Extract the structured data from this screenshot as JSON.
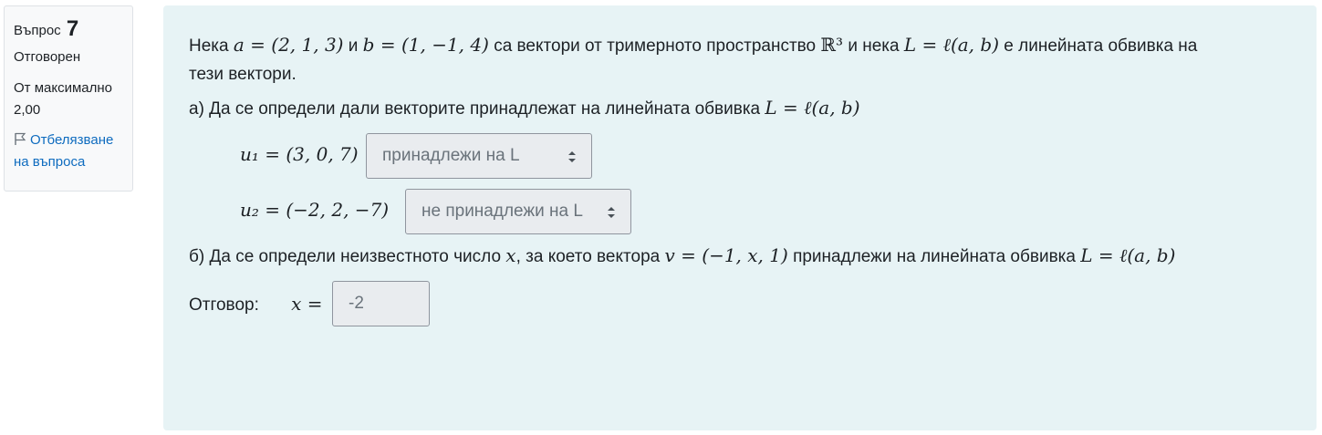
{
  "info": {
    "question_label": "Въпрос",
    "question_number": "7",
    "state": "Отговорен",
    "grade_line1": "От максимално",
    "grade_line2": "2,00",
    "flag_line1": "Отбелязване",
    "flag_line2": "на въпроса"
  },
  "question": {
    "intro_1": "Нека",
    "a_def": "a = (2, 1, 3)",
    "and": "и",
    "b_def": "b = (1, −1, 4)",
    "intro_2": "са вектори от тримерното пространство",
    "space": "ℝ³",
    "intro_3": "и нека",
    "L_def": "L = ℓ(a, b)",
    "intro_4": "е  линейната обвивка на",
    "intro_5": "тези вектори.",
    "part_a": "а) Да се определи дали векторите принадлежат на линейната обвивка",
    "part_a_math": "L = ℓ(a, b)",
    "u1": "u₁ = (3, 0, 7)",
    "u1_select": "принадлежи на L",
    "u2": "u₂ = (−2, 2, −7)",
    "u2_select": "не принадлежи на L",
    "part_b_1": "б) Да се определи неизвестното число",
    "part_b_x": "x",
    "part_b_2": ", за което вектора",
    "part_b_v": "v = (−1, x, 1)",
    "part_b_3": "принадлежи на линейната обвивка",
    "part_b_math": "L = ℓ(a, b)",
    "answer_label": "Отговор:",
    "answer_math": "x =",
    "answer_value": "-2"
  }
}
